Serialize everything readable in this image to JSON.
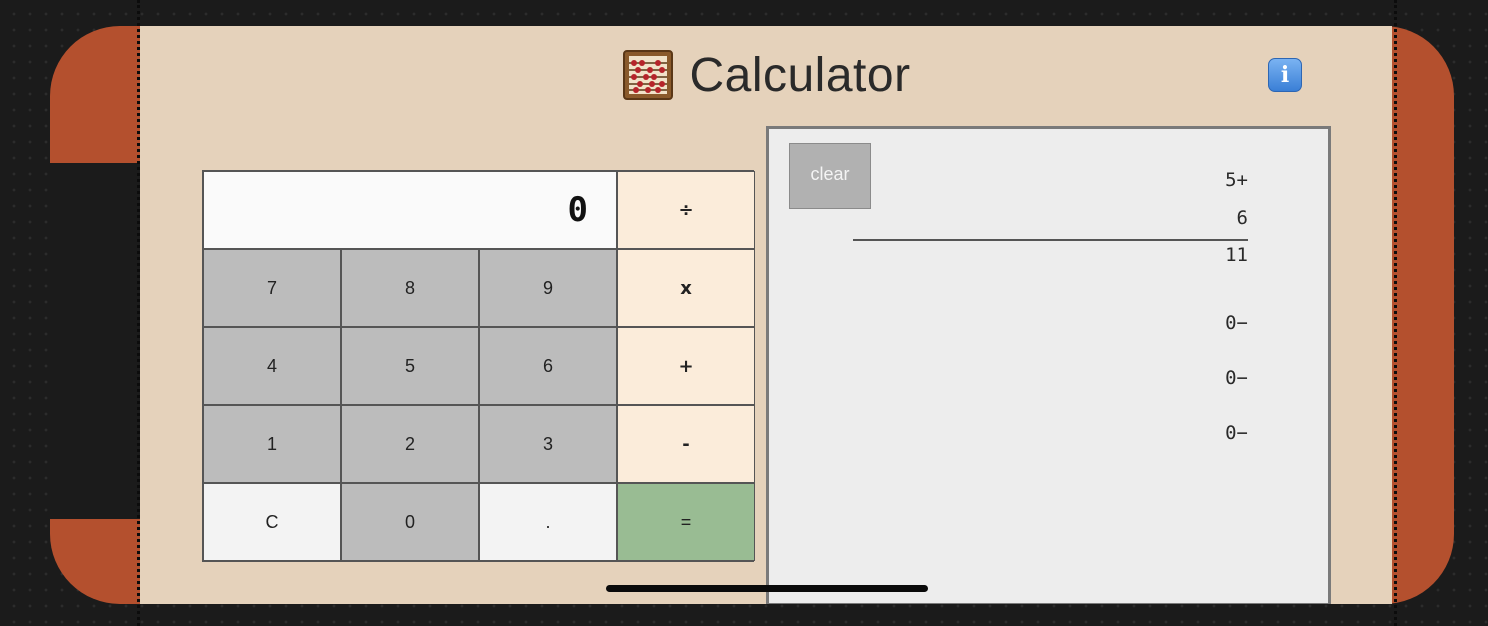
{
  "app": {
    "title": "Calculator",
    "icon": "abacus-icon",
    "info_icon": "info-icon",
    "info_glyph": "i"
  },
  "display": {
    "value": "0"
  },
  "keys": {
    "divide": "÷",
    "multiply": "x",
    "plus": "+",
    "minus": "-",
    "equals": "=",
    "k7": "7",
    "k8": "8",
    "k9": "9",
    "k4": "4",
    "k5": "5",
    "k6": "6",
    "k1": "1",
    "k2": "2",
    "k3": "3",
    "clear_entry": "C",
    "k0": "0",
    "decimal": "."
  },
  "tape": {
    "clear_label": "clear",
    "lines": [
      "5+",
      "6",
      "11",
      "0−",
      "0−",
      "0−"
    ]
  },
  "colors": {
    "frame": "#b4502e",
    "screen": "#e5d2bb",
    "number_key": "#bcbcbc",
    "operator_key": "#fbecda",
    "equals_key": "#99bc93"
  }
}
